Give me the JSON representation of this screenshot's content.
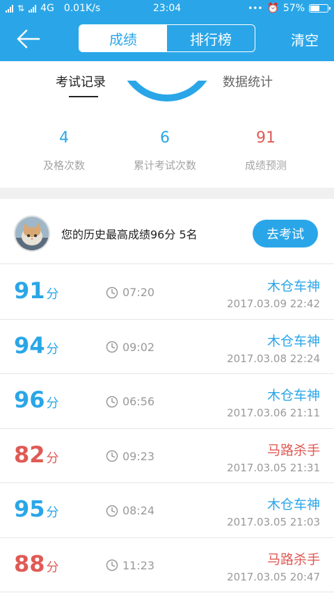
{
  "status_bar": {
    "network": "4G",
    "speed": "0.01K/s",
    "time": "23:04",
    "dots": "•••",
    "alarm_icon": "alarm-icon",
    "battery_text": "57%",
    "battery_level": 0.57
  },
  "header": {
    "back_icon": "back-arrow-icon",
    "tabs": [
      {
        "label": "成绩",
        "active": true
      },
      {
        "label": "排行榜",
        "active": false
      }
    ],
    "clear_label": "清空"
  },
  "sub_tabs": [
    {
      "label": "考试记录",
      "active": true
    },
    {
      "label": "数据统计",
      "active": false
    }
  ],
  "stats": [
    {
      "value": "4",
      "label": "及格次数",
      "color": "#2aa6e8"
    },
    {
      "value": "6",
      "label": "累计考试次数",
      "color": "#2aa6e8"
    },
    {
      "value": "91",
      "label": "成绩预测",
      "color": "#e05a55"
    }
  ],
  "best": {
    "avatar_icon": "cat-avatar",
    "text": "您的历史最高成绩96分  5名",
    "button_label": "去考试"
  },
  "records": [
    {
      "score": "91",
      "unit": "分",
      "duration": "07:20",
      "name": "木仓车神",
      "date": "2017.03.09  22:42",
      "color": "#2aa6e8"
    },
    {
      "score": "94",
      "unit": "分",
      "duration": "09:02",
      "name": "木仓车神",
      "date": "2017.03.08  22:24",
      "color": "#2aa6e8"
    },
    {
      "score": "96",
      "unit": "分",
      "duration": "06:56",
      "name": "木仓车神",
      "date": "2017.03.06  21:11",
      "color": "#2aa6e8"
    },
    {
      "score": "82",
      "unit": "分",
      "duration": "09:23",
      "name": "马路杀手",
      "date": "2017.03.05  21:31",
      "color": "#e05a55"
    },
    {
      "score": "95",
      "unit": "分",
      "duration": "08:24",
      "name": "木仓车神",
      "date": "2017.03.05  21:03",
      "color": "#2aa6e8"
    },
    {
      "score": "88",
      "unit": "分",
      "duration": "11:23",
      "name": "马路杀手",
      "date": "2017.03.05  20:47",
      "color": "#e05a55"
    }
  ],
  "colors": {
    "accent": "#2aa6e8",
    "fail": "#e05a55"
  }
}
